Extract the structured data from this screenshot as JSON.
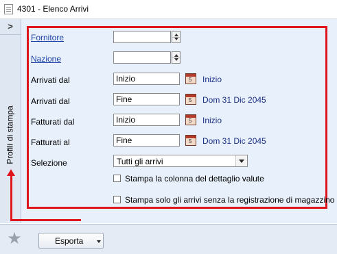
{
  "window": {
    "title": "4301 - Elenco Arrivi"
  },
  "side_panel": {
    "toggle_glyph": ">",
    "tab_label": "Profili di stampa"
  },
  "form": {
    "fornitore": {
      "label": "Fornitore",
      "value": ""
    },
    "nazione": {
      "label": "Nazione",
      "value": ""
    },
    "arrivati_dal_1": {
      "label": "Arrivati dal",
      "value": "Inizio",
      "date_text": "Inizio"
    },
    "arrivati_dal_2": {
      "label": "Arrivati dal",
      "value": "Fine",
      "date_text": "Dom 31 Dic 2045"
    },
    "fatturati_dal": {
      "label": "Fatturati dal",
      "value": "Inizio",
      "date_text": "Inizio"
    },
    "fatturati_al": {
      "label": "Fatturati al",
      "value": "Fine",
      "date_text": "Dom 31 Dic 2045"
    },
    "selezione": {
      "label": "Selezione",
      "selected": "Tutti gli arrivi"
    },
    "check_valute": {
      "label": "Stampa la colonna del dettaglio valute",
      "checked": false
    },
    "check_magazzino": {
      "label": "Stampa solo gli arrivi senza la registrazione di magazzino",
      "checked": false
    }
  },
  "footer": {
    "export_label": "Esporta"
  },
  "icons": {
    "app": "document-icon",
    "spinner": "spinner-icon",
    "calendar": "calendar-icon",
    "dropdown": "chevron-down-icon",
    "favorite": "star-icon"
  },
  "colors": {
    "annotation_red": "#e0141c",
    "link_blue": "#1a3fa6",
    "date_text": "#1a2f86",
    "panel_bg": "#e8f0fb"
  }
}
